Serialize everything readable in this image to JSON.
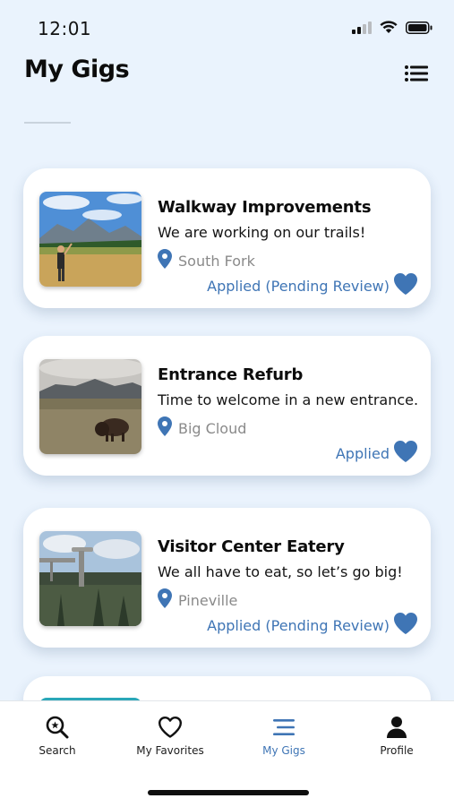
{
  "status_bar": {
    "time": "12:01",
    "icons": [
      "cellular-signal-icon",
      "wifi-icon",
      "battery-icon"
    ]
  },
  "header": {
    "title": "My Gigs",
    "menu_icon": "list-view-icon"
  },
  "colors": {
    "background": "#eaf3fd",
    "accent": "#3f75b5",
    "card": "#ffffff"
  },
  "gigs": [
    {
      "title": "Walkway Improvements",
      "description": "We are working on our trails!",
      "location": "South Fork",
      "status": "Applied (Pending Review)",
      "favorite": true
    },
    {
      "title": "Entrance Refurb",
      "description": "Time to welcome in a new entrance...",
      "location": "Big Cloud",
      "status": "Applied",
      "favorite": true
    },
    {
      "title": "Visitor Center Eatery",
      "description": "We all have to eat, so let’s go big!",
      "location": "Pineville",
      "status": "Applied (Pending Review)",
      "favorite": true
    }
  ],
  "tabs": [
    {
      "label": "Search",
      "icon": "search-icon",
      "active": false
    },
    {
      "label": "My Favorites",
      "icon": "heart-icon",
      "active": false
    },
    {
      "label": "My Gigs",
      "icon": "list-icon",
      "active": true
    },
    {
      "label": "Profile",
      "icon": "person-icon",
      "active": false
    }
  ]
}
